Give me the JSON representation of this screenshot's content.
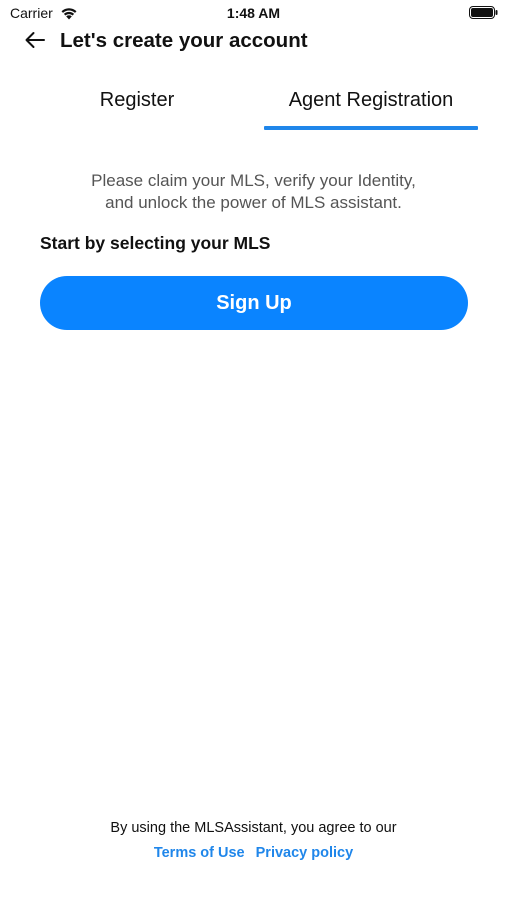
{
  "status_bar": {
    "carrier": "Carrier",
    "time": "1:48 AM",
    "wifi_icon": "wifi-icon",
    "battery_icon": "battery-full-icon"
  },
  "header": {
    "back_icon": "arrow-left-icon",
    "title": "Let's create your account"
  },
  "tabs": [
    {
      "label": "Register",
      "selected": false
    },
    {
      "label": "Agent Registration",
      "selected": true
    }
  ],
  "content": {
    "intro_line1": "Please claim your MLS, verify your Identity,",
    "intro_line2": "and unlock the power of MLS assistant.",
    "section_label": "Start by selecting your MLS",
    "signup_label": "Sign Up"
  },
  "footer": {
    "agreement": "By using the MLSAssistant, you agree to our",
    "terms_label": "Terms of Use",
    "privacy_label": "Privacy policy"
  },
  "colors": {
    "accent": "#1f86ea",
    "button": "#0a84ff",
    "muted_text": "#555555"
  }
}
